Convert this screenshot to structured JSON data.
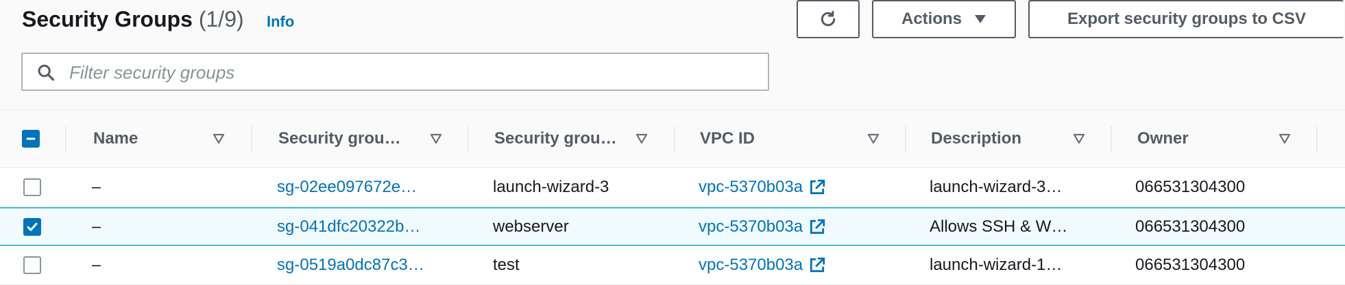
{
  "header": {
    "title": "Security Groups",
    "count": "(1/9)",
    "info_label": "Info",
    "actions_label": "Actions",
    "export_label": "Export security groups to CSV"
  },
  "search": {
    "placeholder": "Filter security groups"
  },
  "table": {
    "columns": [
      "Name",
      "Security grou…",
      "Security grou…",
      "VPC ID",
      "Description",
      "Owner"
    ],
    "rows": [
      {
        "selected": false,
        "name": "–",
        "group_id": "sg-02ee097672e…",
        "group_name": "launch-wizard-3",
        "vpc_id": "vpc-5370b03a",
        "description": "launch-wizard-3…",
        "owner": "066531304300"
      },
      {
        "selected": true,
        "name": "–",
        "group_id": "sg-041dfc20322b…",
        "group_name": "webserver",
        "vpc_id": "vpc-5370b03a",
        "description": "Allows SSH & W…",
        "owner": "066531304300"
      },
      {
        "selected": false,
        "name": "–",
        "group_id": "sg-0519a0dc87c3…",
        "group_name": "test",
        "vpc_id": "vpc-5370b03a",
        "description": "launch-wizard-1…",
        "owner": "066531304300"
      }
    ]
  },
  "colors": {
    "link": "#0073bb",
    "selected_row_bg": "#f1faff",
    "selected_row_border": "#44b9d6",
    "header_bg": "#fafafa"
  },
  "icons": [
    "search-icon",
    "refresh-icon",
    "caret-down-icon",
    "sort-icon",
    "external-link-icon",
    "checkbox-checked-icon",
    "checkbox-indeterminate-icon"
  ]
}
